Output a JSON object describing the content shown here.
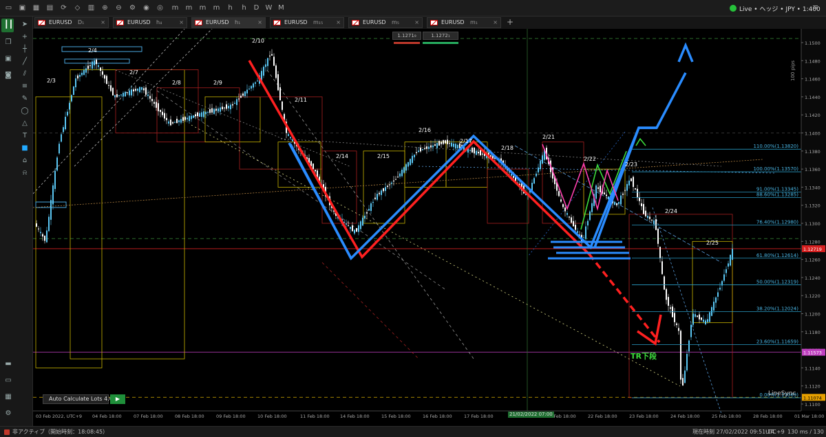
{
  "account": {
    "text": "Live • ヘッジ • JPY • 1:400"
  },
  "tabs": [
    {
      "symbol": "EURUSD",
      "timeframe": "D₁"
    },
    {
      "symbol": "EURUSD",
      "timeframe": "h₄"
    },
    {
      "symbol": "EURUSD",
      "timeframe": "h₁"
    },
    {
      "symbol": "EURUSD",
      "timeframe": "m₁₅"
    },
    {
      "symbol": "EURUSD",
      "timeframe": "m₅"
    },
    {
      "symbol": "EURUSD",
      "timeframe": "m₁"
    }
  ],
  "quote": {
    "bid": "1.1271₉",
    "ask": "1.1272₁"
  },
  "price_axis": {
    "ticks": [
      "1.1500",
      "1.1480",
      "1.1460",
      "1.1440",
      "1.1420",
      "1.1400",
      "1.1380",
      "1.1360",
      "1.1340",
      "1.1320",
      "1.1300",
      "1.1280",
      "1.1260",
      "1.1240",
      "1.1220",
      "1.1200",
      "1.1180",
      "1.1160",
      "1.1140",
      "1.1120",
      "1.1100"
    ],
    "current": "1.12719",
    "pink_marker": "1.11573",
    "low_marker": "1.11074",
    "pips_label": "100 pips"
  },
  "time_axis": [
    "03 Feb 2022, UTC+9",
    "04 Feb 18:00",
    "07 Feb 18:00",
    "08 Feb 18:00",
    "09 Feb 18:00",
    "10 Feb 18:00",
    "11 Feb 18:00",
    "14 Feb 18:00",
    "15 Feb 18:00",
    "16 Feb 18:00",
    "17 Feb 18:00",
    "21 Feb 18:00",
    "22 Feb 18:00",
    "23 Feb 18:00",
    "24 Feb 18:00",
    "25 Feb 18:00",
    "28 Feb 18:00",
    "01 Mar 18:00"
  ],
  "crosshair_time": "21/02/2022 07:00",
  "fib_levels": [
    {
      "label": "110.00%(1.13820)"
    },
    {
      "label": "100.00%(1.13570)"
    },
    {
      "label": "91.00%(1.13345)"
    },
    {
      "label": "88.60%(1.13285)"
    },
    {
      "label": "76.40%(1.12980)"
    },
    {
      "label": "61.80%(1.12614)"
    },
    {
      "label": "50.00%(1.12319)"
    },
    {
      "label": "38.20%(1.12024)"
    },
    {
      "label": "23.60%(1.11659)"
    },
    {
      "label": "0.00%(1.11069)"
    }
  ],
  "day_labels": [
    "2/3",
    "2/4",
    "2/7",
    "2/8",
    "2/9",
    "2/10",
    "2/11",
    "2/14",
    "2/15",
    "2/16",
    "2/17",
    "2/18",
    "2/21",
    "2/22",
    "2/23",
    "2/24",
    "2/25"
  ],
  "annotation": "TR下段",
  "indicator": {
    "name": "LineSync"
  },
  "plugin": {
    "label": "Auto Calculate Lots 4.0",
    "run": "▶"
  },
  "status": {
    "left": "非アクティブ（開始時刻：18:08:45）",
    "time": "現在時刻  27/02/2022 09:51:14",
    "tz": "UTC+9",
    "ping": "130 ms / 130 ms"
  },
  "colors": {
    "bull": "#5bc8f5",
    "bear": "#ffffff",
    "red_path": "#ff2020",
    "blue_path": "#2a8cff",
    "green": "#3cdc3c",
    "pink": "#ff40b0"
  }
}
